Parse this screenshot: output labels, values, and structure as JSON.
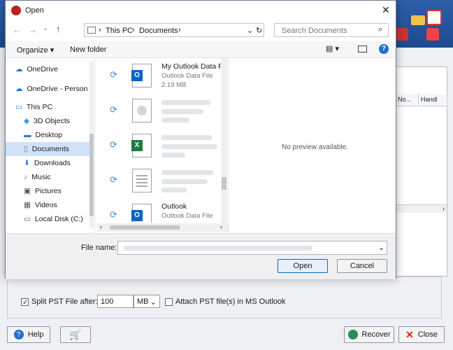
{
  "dialog": {
    "title": "Open",
    "address_path": [
      "This PC",
      "Documents"
    ],
    "search_placeholder": "Search Documents",
    "organize_label": "Organize",
    "new_folder_label": "New folder",
    "preview_text": "No preview available.",
    "file_name_label": "File name:",
    "open_label": "Open",
    "cancel_label": "Cancel"
  },
  "nav": {
    "items": [
      {
        "label": "OneDrive",
        "icon": "cloud-icon"
      },
      {
        "label": "OneDrive - Person",
        "icon": "cloud-icon"
      },
      {
        "label": "This PC",
        "icon": "computer-icon"
      },
      {
        "label": "3D Objects",
        "icon": "cube-icon"
      },
      {
        "label": "Desktop",
        "icon": "desktop-icon"
      },
      {
        "label": "Documents",
        "icon": "document-icon",
        "selected": true
      },
      {
        "label": "Downloads",
        "icon": "download-icon"
      },
      {
        "label": "Music",
        "icon": "music-icon"
      },
      {
        "label": "Pictures",
        "icon": "picture-icon"
      },
      {
        "label": "Videos",
        "icon": "video-icon"
      },
      {
        "label": "Local Disk (C:)",
        "icon": "disk-icon"
      }
    ]
  },
  "files": [
    {
      "name": "My Outlook Data F",
      "type": "Outlook Data File",
      "size": "2.19 MB",
      "icon": "outlook-icon"
    },
    {
      "name": "",
      "type": "",
      "size": "",
      "icon": "disc-icon"
    },
    {
      "name": "",
      "type": "",
      "size": "",
      "icon": "excel-icon"
    },
    {
      "name": "",
      "type": "",
      "size": "",
      "icon": "text-file-icon"
    },
    {
      "name": "Outlook",
      "type": "Outlook Data File",
      "size": "",
      "icon": "outlook-icon"
    }
  ],
  "app": {
    "column_headers": [
      "t No...",
      "Handl"
    ],
    "split_label": "Split PST File after:",
    "split_value": "100",
    "split_unit": "MB",
    "attach_label": "Attach PST file(s) in MS Outlook",
    "help_label": "Help",
    "recover_label": "Recover",
    "close_label": "Close"
  },
  "colors": {
    "accent": "#0a63c9",
    "selection": "#cfe2f7",
    "outlook_blue": "#0a63c9",
    "excel_green": "#1f7a45"
  }
}
